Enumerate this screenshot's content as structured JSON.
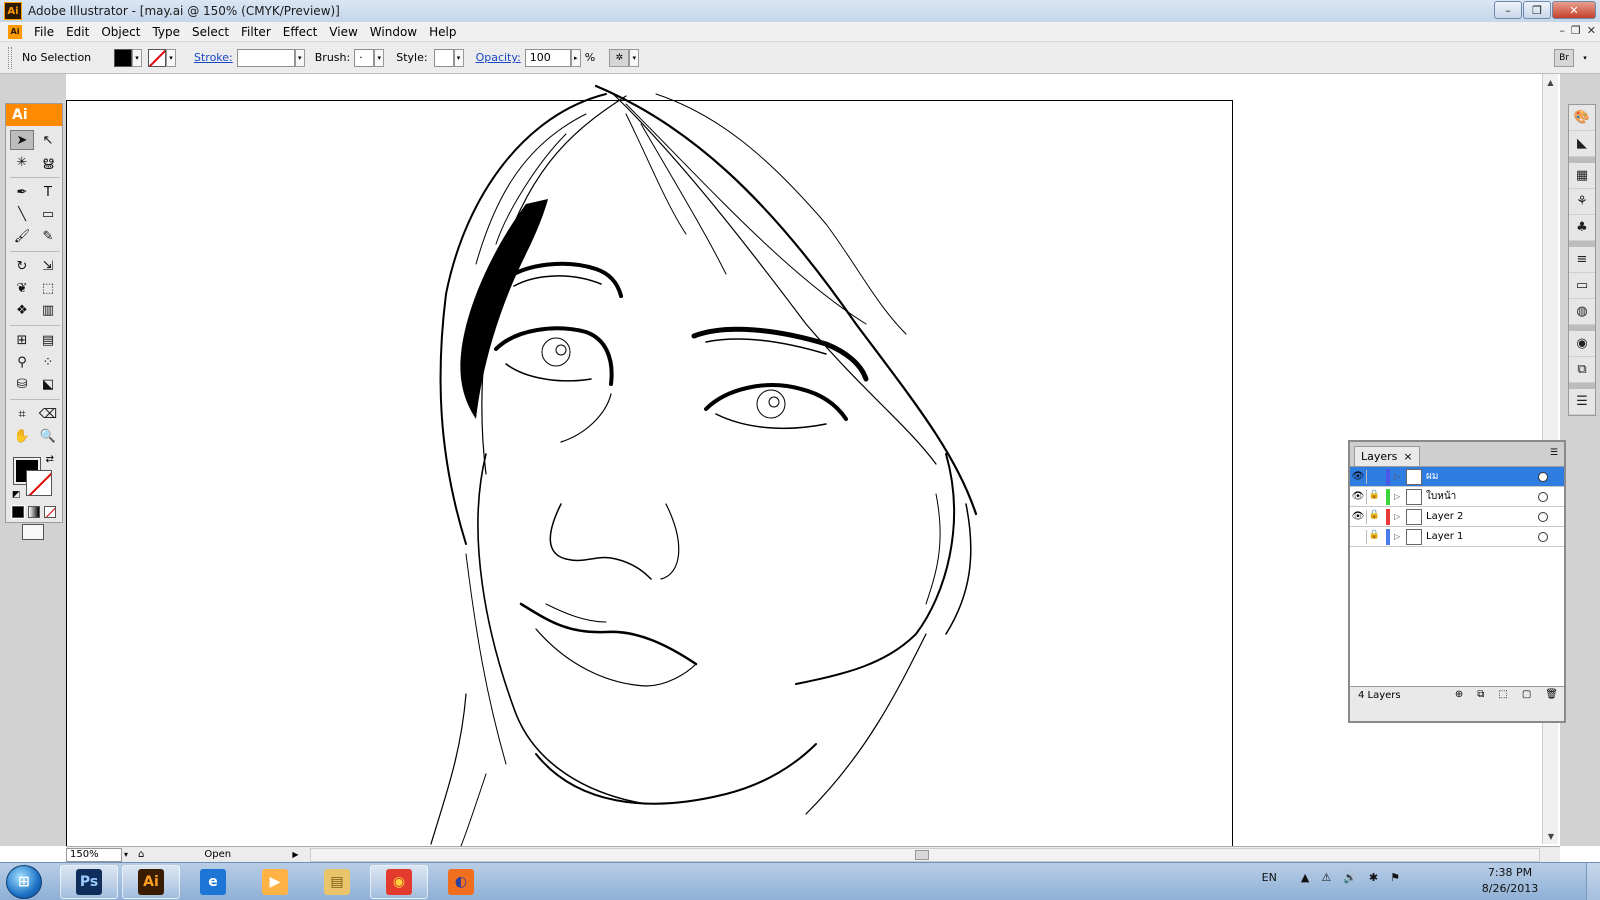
{
  "window": {
    "title": "Adobe Illustrator - [may.ai @ 150% (CMYK/Preview)]",
    "app_logo": "Ai",
    "minimize": "–",
    "restore": "❐",
    "close": "✕"
  },
  "menubar": {
    "items": [
      "File",
      "Edit",
      "Object",
      "Type",
      "Select",
      "Filter",
      "Effect",
      "View",
      "Window",
      "Help"
    ],
    "doc_controls": [
      "–",
      "❐",
      "✕"
    ]
  },
  "controlbar": {
    "selection": "No Selection",
    "stroke_label": "Stroke:",
    "brush_label": "Brush:",
    "brush_value": "·",
    "style_label": "Style:",
    "opacity_label": "Opacity:",
    "opacity_value": "100",
    "opacity_unit": "%",
    "bridge_icon": "Br"
  },
  "tools": {
    "header": "Ai",
    "items": [
      {
        "name": "selection-tool-icon",
        "glyph": "➤",
        "active": true
      },
      {
        "name": "direct-selection-tool-icon",
        "glyph": "↖"
      },
      {
        "name": "magic-wand-tool-icon",
        "glyph": "✳"
      },
      {
        "name": "lasso-tool-icon",
        "glyph": "ൠ"
      },
      {
        "name": "pen-tool-icon",
        "glyph": "✒"
      },
      {
        "name": "type-tool-icon",
        "glyph": "T"
      },
      {
        "name": "line-tool-icon",
        "glyph": "╲"
      },
      {
        "name": "rectangle-tool-icon",
        "glyph": "▭"
      },
      {
        "name": "paintbrush-tool-icon",
        "glyph": "🖌"
      },
      {
        "name": "pencil-tool-icon",
        "glyph": "✎"
      },
      {
        "name": "rotate-tool-icon",
        "glyph": "↻"
      },
      {
        "name": "scale-tool-icon",
        "glyph": "⇲"
      },
      {
        "name": "warp-tool-icon",
        "glyph": "❦"
      },
      {
        "name": "free-transform-tool-icon",
        "glyph": "⬚"
      },
      {
        "name": "symbol-sprayer-tool-icon",
        "glyph": "❖"
      },
      {
        "name": "column-graph-tool-icon",
        "glyph": "▥"
      },
      {
        "name": "mesh-tool-icon",
        "glyph": "⊞"
      },
      {
        "name": "gradient-tool-icon",
        "glyph": "▤"
      },
      {
        "name": "eyedropper-tool-icon",
        "glyph": "⚲"
      },
      {
        "name": "blend-tool-icon",
        "glyph": "⁘"
      },
      {
        "name": "live-paint-bucket-tool-icon",
        "glyph": "⛁"
      },
      {
        "name": "live-paint-selection-tool-icon",
        "glyph": "⬕"
      },
      {
        "name": "crop-area-tool-icon",
        "glyph": "⌗"
      },
      {
        "name": "eraser-tool-icon",
        "glyph": "⌫"
      },
      {
        "name": "hand-tool-icon",
        "glyph": "✋"
      },
      {
        "name": "zoom-tool-icon",
        "glyph": "🔍"
      }
    ]
  },
  "dock": {
    "icons": [
      "color-guide-icon",
      "color-icon",
      "swatches-icon",
      "brushes-icon",
      "symbols-icon",
      "stroke-icon",
      "gradient-icon",
      "transparency-icon",
      "appearance-icon",
      "graphic-styles-icon",
      "layers-icon"
    ]
  },
  "layers": {
    "tab": "Layers",
    "tab_close": "×",
    "count": "4 Layers",
    "rows": [
      {
        "name": "ผม",
        "color": "#4a57e8",
        "eye": true,
        "lock": false,
        "selected": true
      },
      {
        "name": "ใบหน้า",
        "color": "#3ad63a",
        "eye": true,
        "lock": true,
        "selected": false
      },
      {
        "name": "Layer 2",
        "color": "#e83a3a",
        "eye": true,
        "lock": true,
        "selected": false
      },
      {
        "name": "Layer 1",
        "color": "#4a7de8",
        "eye": false,
        "lock": true,
        "selected": false
      }
    ]
  },
  "statusbar": {
    "zoom": "150%",
    "status": "Open"
  },
  "taskbar": {
    "apps": [
      {
        "name": "photoshop",
        "label": "Ps",
        "bg": "#0f2e5c",
        "fg": "#9ecbff",
        "pinned": true
      },
      {
        "name": "illustrator",
        "label": "Ai",
        "bg": "#3a1d00",
        "fg": "#ffa020",
        "pinned": true
      },
      {
        "name": "internet-explorer",
        "label": "e",
        "bg": "#1d75d6",
        "fg": "#ffffff",
        "pinned": false
      },
      {
        "name": "media-player",
        "label": "▶",
        "bg": "#ffb347",
        "fg": "#ffffff",
        "pinned": false
      },
      {
        "name": "file-explorer",
        "label": "▤",
        "bg": "#e9c46a",
        "fg": "#7a5b12",
        "pinned": false
      },
      {
        "name": "chrome",
        "label": "◉",
        "bg": "#e33b2e",
        "fg": "#ffd43b",
        "pinned": true
      },
      {
        "name": "firefox",
        "label": "◐",
        "bg": "#f06f1e",
        "fg": "#2a3f9e",
        "pinned": false
      }
    ],
    "language": "EN",
    "time": "7:38 PM",
    "date": "8/26/2013"
  }
}
